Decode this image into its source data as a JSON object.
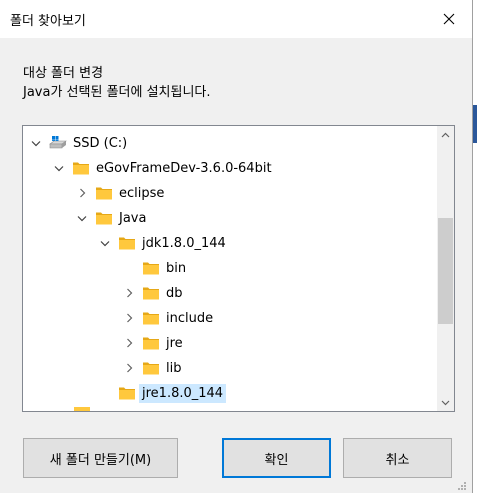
{
  "dialog": {
    "title": "폴더 찾아보기",
    "description_line1": "대상 폴더 변경",
    "description_line2": "Java가 선택된 폴더에 설치됩니다."
  },
  "tree": {
    "items": [
      {
        "label": "SSD (C:)",
        "icon": "drive-icon",
        "expander": "expanded"
      },
      {
        "label": "eGovFrameDev-3.6.0-64bit",
        "icon": "folder-icon",
        "expander": "expanded"
      },
      {
        "label": "eclipse",
        "icon": "folder-icon",
        "expander": "collapsed"
      },
      {
        "label": "Java",
        "icon": "folder-icon",
        "expander": "expanded"
      },
      {
        "label": "jdk1.8.0_144",
        "icon": "folder-icon",
        "expander": "expanded"
      },
      {
        "label": "bin",
        "icon": "folder-icon",
        "expander": "none"
      },
      {
        "label": "db",
        "icon": "folder-icon",
        "expander": "collapsed"
      },
      {
        "label": "include",
        "icon": "folder-icon",
        "expander": "collapsed"
      },
      {
        "label": "jre",
        "icon": "folder-icon",
        "expander": "collapsed"
      },
      {
        "label": "lib",
        "icon": "folder-icon",
        "expander": "collapsed"
      },
      {
        "label": "jre1.8.0_144",
        "icon": "folder-icon",
        "expander": "none",
        "selected": true
      }
    ]
  },
  "buttons": {
    "new_folder": "새 폴더 만들기(M)",
    "ok": "확인",
    "cancel": "취소"
  },
  "colors": {
    "selection": "#cce8ff",
    "folder": "#ffc83d",
    "default_button_border": "#0078d7"
  }
}
